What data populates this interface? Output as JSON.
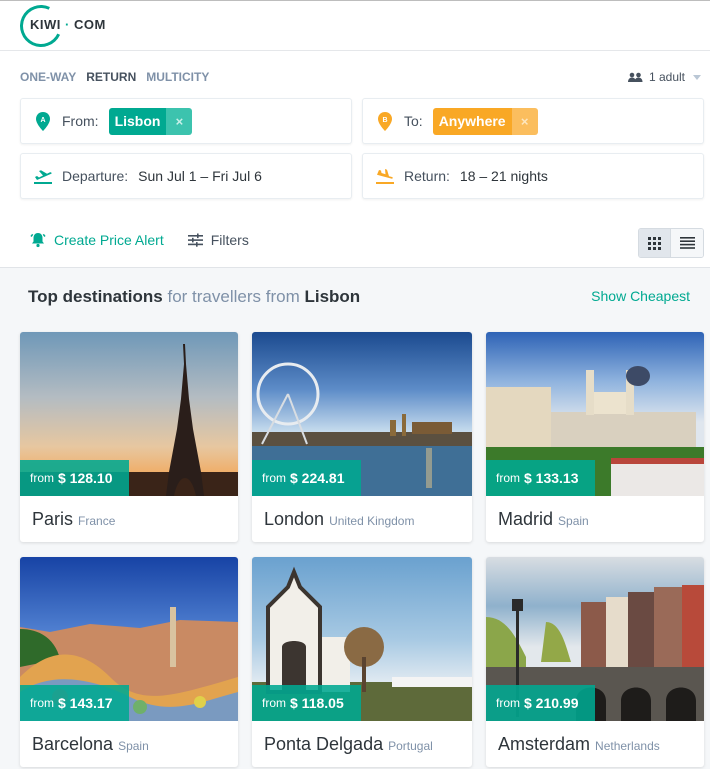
{
  "header": {
    "logo_left": "KIWI",
    "logo_dot": "·",
    "logo_right": "COM"
  },
  "trip_types": [
    {
      "label": "ONE-WAY",
      "active": false
    },
    {
      "label": "RETURN",
      "active": true
    },
    {
      "label": "MULTICITY",
      "active": false
    }
  ],
  "passengers": {
    "label": "1 adult",
    "icon": "users-icon"
  },
  "search": {
    "from": {
      "label": "From:",
      "value": "Lisbon",
      "icon": "pin-a-icon"
    },
    "to": {
      "label": "To:",
      "value": "Anywhere",
      "icon": "pin-b-icon"
    },
    "departure": {
      "label": "Departure:",
      "value": "Sun Jul 1 – Fri Jul 6",
      "icon": "takeoff-icon"
    },
    "return": {
      "label": "Return:",
      "value": "18 – 21 nights",
      "icon": "landing-icon"
    },
    "remove_symbol": "×"
  },
  "actions": {
    "price_alert": "Create Price Alert",
    "filters": "Filters"
  },
  "view_modes": [
    "grid",
    "list"
  ],
  "section": {
    "title_bold": "Top destinations",
    "title_mid": "for travellers from",
    "title_city": "Lisbon",
    "show_cheapest": "Show Cheapest"
  },
  "colors": {
    "brand": "#00a991",
    "accent_orange": "#f9a825"
  },
  "destinations": [
    {
      "city": "Paris",
      "country": "France",
      "from": "from",
      "price": "$ 128.10",
      "scene": "paris"
    },
    {
      "city": "London",
      "country": "United Kingdom",
      "from": "from",
      "price": "$ 224.81",
      "scene": "london"
    },
    {
      "city": "Madrid",
      "country": "Spain",
      "from": "from",
      "price": "$ 133.13",
      "scene": "madrid"
    },
    {
      "city": "Barcelona",
      "country": "Spain",
      "from": "from",
      "price": "$ 143.17",
      "scene": "barcelona"
    },
    {
      "city": "Ponta Delgada",
      "country": "Portugal",
      "from": "from",
      "price": "$ 118.05",
      "scene": "ponta"
    },
    {
      "city": "Amsterdam",
      "country": "Netherlands",
      "from": "from",
      "price": "$ 210.99",
      "scene": "amsterdam"
    }
  ]
}
